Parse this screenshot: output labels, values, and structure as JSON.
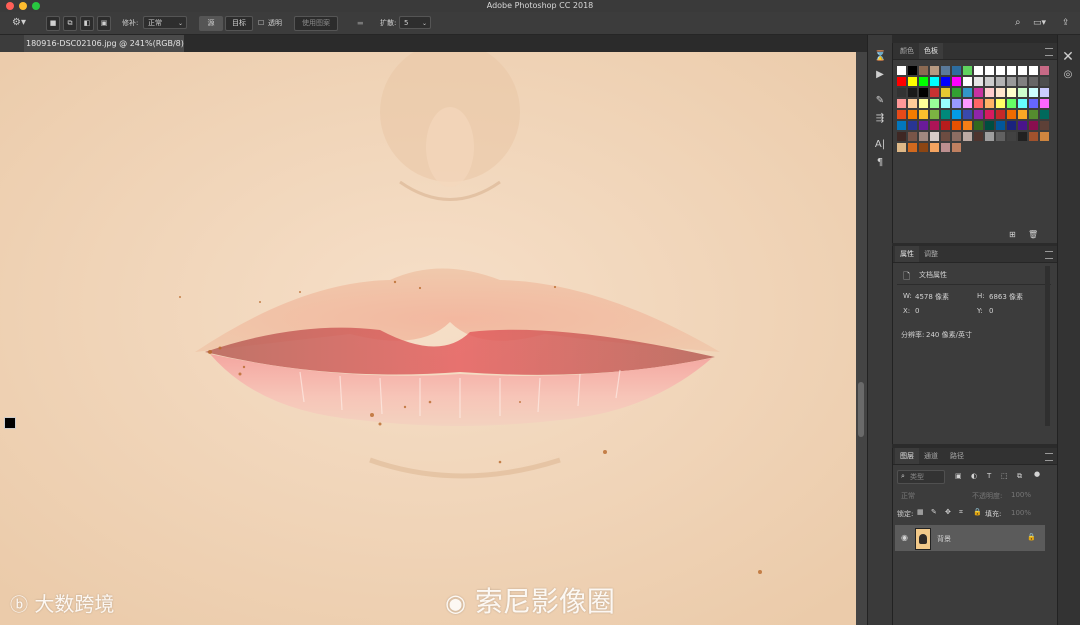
{
  "window": {
    "title": "Adobe Photoshop CC 2018"
  },
  "options_bar": {
    "mode_label": "修补:",
    "mode_value": "正常",
    "source_button": "源",
    "target_button": "目标",
    "transparent_label": "透明",
    "use_pattern_button": "使用图案",
    "diffusion_label": "扩散:",
    "diffusion_value": "5"
  },
  "document_tab": {
    "title": "180916-DSC02106.jpg @ 241%(RGB/8) *"
  },
  "color_panel": {
    "tabs": [
      "颜色",
      "色板"
    ],
    "active_tab": "色板"
  },
  "properties_panel": {
    "tabs": [
      "属性",
      "调整"
    ],
    "active_tab": "属性",
    "section_title": "文档属性",
    "width_label": "W:",
    "width_value": "4578 像素",
    "height_label": "H:",
    "height_value": "6863 像素",
    "x_label": "X:",
    "x_value": "0",
    "y_label": "Y:",
    "y_value": "0",
    "resolution_label": "分辨率:",
    "resolution_value": "240 像素/英寸"
  },
  "layers_panel": {
    "tabs": [
      "图层",
      "通道",
      "路径"
    ],
    "active_tab": "图层",
    "filter_placeholder": "类型",
    "blend_mode": "正常",
    "opacity_label": "不透明度:",
    "opacity_value": "100%",
    "lock_label": "锁定:",
    "fill_label": "填充:",
    "fill_value": "100%",
    "layer_name": "背景"
  },
  "watermarks": {
    "left": "大数跨境",
    "center": "索尼影像圈"
  },
  "swatches": [
    "#ffffff",
    "#000000",
    "#8c6a52",
    "#b79a82",
    "#5a7a9a",
    "#2d6da0",
    "#5fd35f",
    "#ffffff",
    "#ffffff",
    "#ffffff",
    "#ffffff",
    "#ffffff",
    "#ffffff",
    "#c86a86",
    "#ff0000",
    "#ffff00",
    "#00ff00",
    "#00ffff",
    "#0000ff",
    "#ff00ff",
    "#ffffff",
    "#e6e6e6",
    "#cccccc",
    "#b3b3b3",
    "#999999",
    "#808080",
    "#666666",
    "#4d4d4d",
    "#333333",
    "#1a1a1a",
    "#000000",
    "#c83232",
    "#e6c832",
    "#32a032",
    "#3296c8",
    "#c832a0",
    "#ffcccc",
    "#ffe6cc",
    "#ffffcc",
    "#ccffcc",
    "#ccffff",
    "#ccccff",
    "#ff9999",
    "#ffcc99",
    "#ffff99",
    "#99ff99",
    "#99ffff",
    "#9999ff",
    "#ff99ff",
    "#ff6666",
    "#ffb366",
    "#ffff66",
    "#66ff66",
    "#66ffff",
    "#6666ff",
    "#ff66ff",
    "#e64a19",
    "#f57c00",
    "#fbc02d",
    "#7cb342",
    "#00897b",
    "#039be5",
    "#3949ab",
    "#8e24aa",
    "#d81b60",
    "#c62828",
    "#ef6c00",
    "#f9a825",
    "#558b2f",
    "#00695c",
    "#0277bd",
    "#283593",
    "#6a1b9a",
    "#ad1457",
    "#b71c1c",
    "#e65100",
    "#f57f17",
    "#33691e",
    "#004d40",
    "#01579b",
    "#1a237e",
    "#4a148c",
    "#880e4f",
    "#5d4037",
    "#3e2723",
    "#795548",
    "#a1887f",
    "#d7ccc8",
    "#6d4c41",
    "#8d6e63",
    "#bcaaa4",
    "#4e342e",
    "#9e9e9e",
    "#616161",
    "#424242",
    "#212121",
    "#a0522d",
    "#cd853f",
    "#deb887",
    "#d2691e",
    "#8b4513",
    "#f4a460",
    "#bc8f8f",
    "#c08060"
  ]
}
